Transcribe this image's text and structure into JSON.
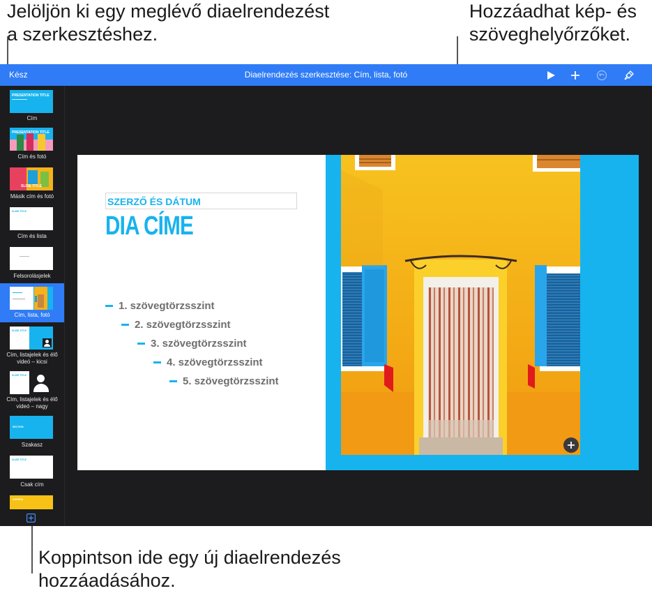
{
  "callouts": {
    "top_left": [
      "Jelöljön ki egy meglévő diaelrendezést",
      "a szerkesztéshez."
    ],
    "top_right": [
      "Hozzáadhat kép- és",
      "szöveghelyőrzőket."
    ],
    "bottom": [
      "Koppintson ide egy új diaelrendezés",
      "hozzáadásához."
    ]
  },
  "toolbar": {
    "done_label": "Kész",
    "title": "Diaelrendezés szerkesztése: Cím, lista, fotó"
  },
  "sidebar": {
    "items": [
      {
        "label": "Cím",
        "thumb_text": "PRESENTATION TITLE"
      },
      {
        "label": "Cím és fotó",
        "thumb_text": "PRESENTATION TITLE"
      },
      {
        "label": "Másik cím és fotó",
        "thumb_text": "SLIDE TITLE"
      },
      {
        "label": "Cím és lista",
        "thumb_text": "SLIDE TITLE"
      },
      {
        "label": "Felsorolásjelek",
        "thumb_text": ""
      },
      {
        "label": "Cím, lista, fotó",
        "thumb_text": ""
      },
      {
        "label": "Cím, listajelek és élő videó – kicsi",
        "thumb_text": "SLIDE TITLE"
      },
      {
        "label": "Cím, listajelek és élő videó – nagy",
        "thumb_text": "SLIDE TITLE"
      },
      {
        "label": "Szakasz",
        "thumb_text": "SECTION"
      },
      {
        "label": "Csak cím",
        "thumb_text": "SLIDE TITLE"
      },
      {
        "label": "",
        "thumb_text": "AGENDA"
      }
    ],
    "selected_index": 5
  },
  "slide": {
    "author_date": "SZERZŐ ÉS DÁTUM",
    "title": "DIA CÍME",
    "bullets": [
      "1. szövegtörzsszint",
      "2. szövegtörzsszint",
      "3. szövegtörzsszint",
      "4. szövegtörzsszint",
      "5. szövegtörzsszint"
    ]
  },
  "colors": {
    "toolbar": "#2f7cf6",
    "accent_blue": "#17b3ee",
    "app_background": "#1c1c1e",
    "wall_yellow": "#f5b21b"
  },
  "icons": {
    "play": "play-icon",
    "add": "plus-icon",
    "undo": "undo-icon",
    "format": "paintbrush-icon",
    "add_layout": "plus-square-icon",
    "add_media": "plus-circle-icon"
  }
}
